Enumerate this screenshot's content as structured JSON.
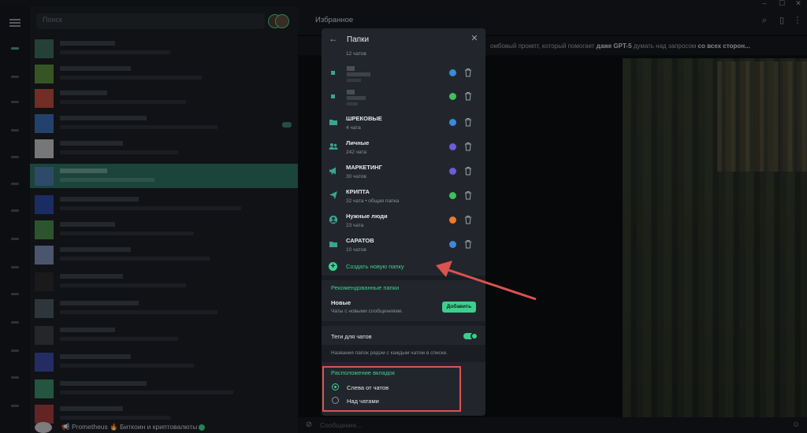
{
  "window": {
    "minimize_glyph": "–",
    "maximize_glyph": "☐",
    "close_glyph": "✕"
  },
  "sidebar": {
    "search_placeholder": "Поиск"
  },
  "last_chat": {
    "title": "📢 Prometheus 🔥 Биткоин и криптовалюты"
  },
  "chat": {
    "title": "Избранное",
    "pinned_before": "омбовый промпт, который помогает ",
    "pinned_bold1": "даже GPT-5",
    "pinned_mid": " думать над запросом ",
    "pinned_bold2": "со всех сторон...",
    "composer_placeholder": "Сообщение..."
  },
  "dialog": {
    "title": "Папки",
    "top_partial_count": "12 чатов",
    "folders": [
      {
        "name": "ШРЕКОВЫЕ",
        "count": "4 чата",
        "color": "#3b8ad8",
        "icon": "folder-icon"
      },
      {
        "name": "Личные",
        "count": "242 чата",
        "color": "#6e5bd8",
        "icon": "people-icon"
      },
      {
        "name": "МАРКЕТИНГ",
        "count": "30 чатов",
        "color": "#6e5bd8",
        "icon": "megaphone-icon"
      },
      {
        "name": "КРИПТА",
        "count": "32 чата • общая папка",
        "color": "#3ec15a",
        "icon": "send-icon"
      },
      {
        "name": "Нужные люди",
        "count": "23 чата",
        "color": "#ee7a2a",
        "icon": "person-icon"
      },
      {
        "name": "САРАТОВ",
        "count": "10 чатов",
        "color": "#3b8ad8",
        "icon": "folder-icon"
      }
    ],
    "blurred_folder_colors": [
      "#3b8ad8",
      "#3ec15a"
    ],
    "create_label": "Создать новую папку",
    "recommended_title": "Рекомендованные папки",
    "recommended": {
      "name": "Новые",
      "desc": "Чаты с новыми сообщениями.",
      "button": "Добавить"
    },
    "tags_label": "Теги для чатов",
    "tags_enabled": true,
    "tags_desc": "Названия папок рядом с каждым чатом в списке.",
    "tabs_title": "Расположение вкладок",
    "tabs_options": [
      {
        "label": "Слева от чатов",
        "selected": true
      },
      {
        "label": "Над чатами",
        "selected": false
      }
    ]
  },
  "colors": {
    "accent": "#3ecf8e",
    "highlight": "#d9534f",
    "selected_row": "#2d6f60"
  }
}
